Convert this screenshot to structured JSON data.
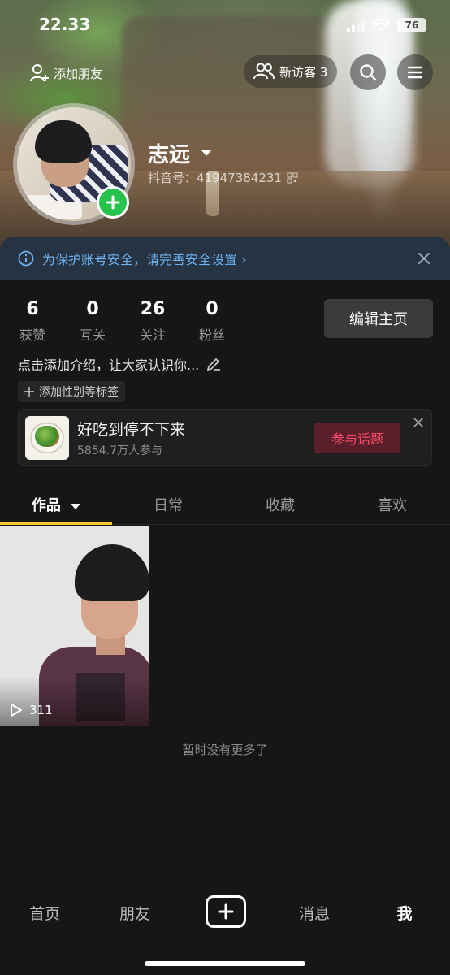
{
  "status_bar": {
    "time": "22.33",
    "battery": "76"
  },
  "header": {
    "add_friend_label": "添加朋友",
    "visitors_label": "新访客 3"
  },
  "profile": {
    "nickname": "志远",
    "douyin_id": "抖音号：41947384231"
  },
  "security_banner": {
    "text": "为保护账号安全，请完善安全设置 ›"
  },
  "stats": [
    {
      "num": "6",
      "label": "获赞"
    },
    {
      "num": "0",
      "label": "互关"
    },
    {
      "num": "26",
      "label": "关注"
    },
    {
      "num": "0",
      "label": "粉丝"
    }
  ],
  "edit_profile_label": "编辑主页",
  "bio_placeholder": "点击添加介绍，让大家认识你...",
  "tag_label": "添加性别等标签",
  "topic": {
    "title": "好吃到停不下来",
    "subtitle": "5854.7万人参与",
    "join_label": "参与话题"
  },
  "tabs": [
    {
      "label": "作品"
    },
    {
      "label": "日常"
    },
    {
      "label": "收藏"
    },
    {
      "label": "喜欢"
    }
  ],
  "video": {
    "plays": "311"
  },
  "no_more_text": "暂时没有更多了",
  "bottom_nav": {
    "home": "首页",
    "friends": "朋友",
    "messages": "消息",
    "me": "我"
  },
  "colors": {
    "accent_underline": "#f7c92f",
    "plus_green": "#27c24c",
    "topic_red": "#ff4d6b",
    "banner_blue": "#6fb2f0"
  }
}
